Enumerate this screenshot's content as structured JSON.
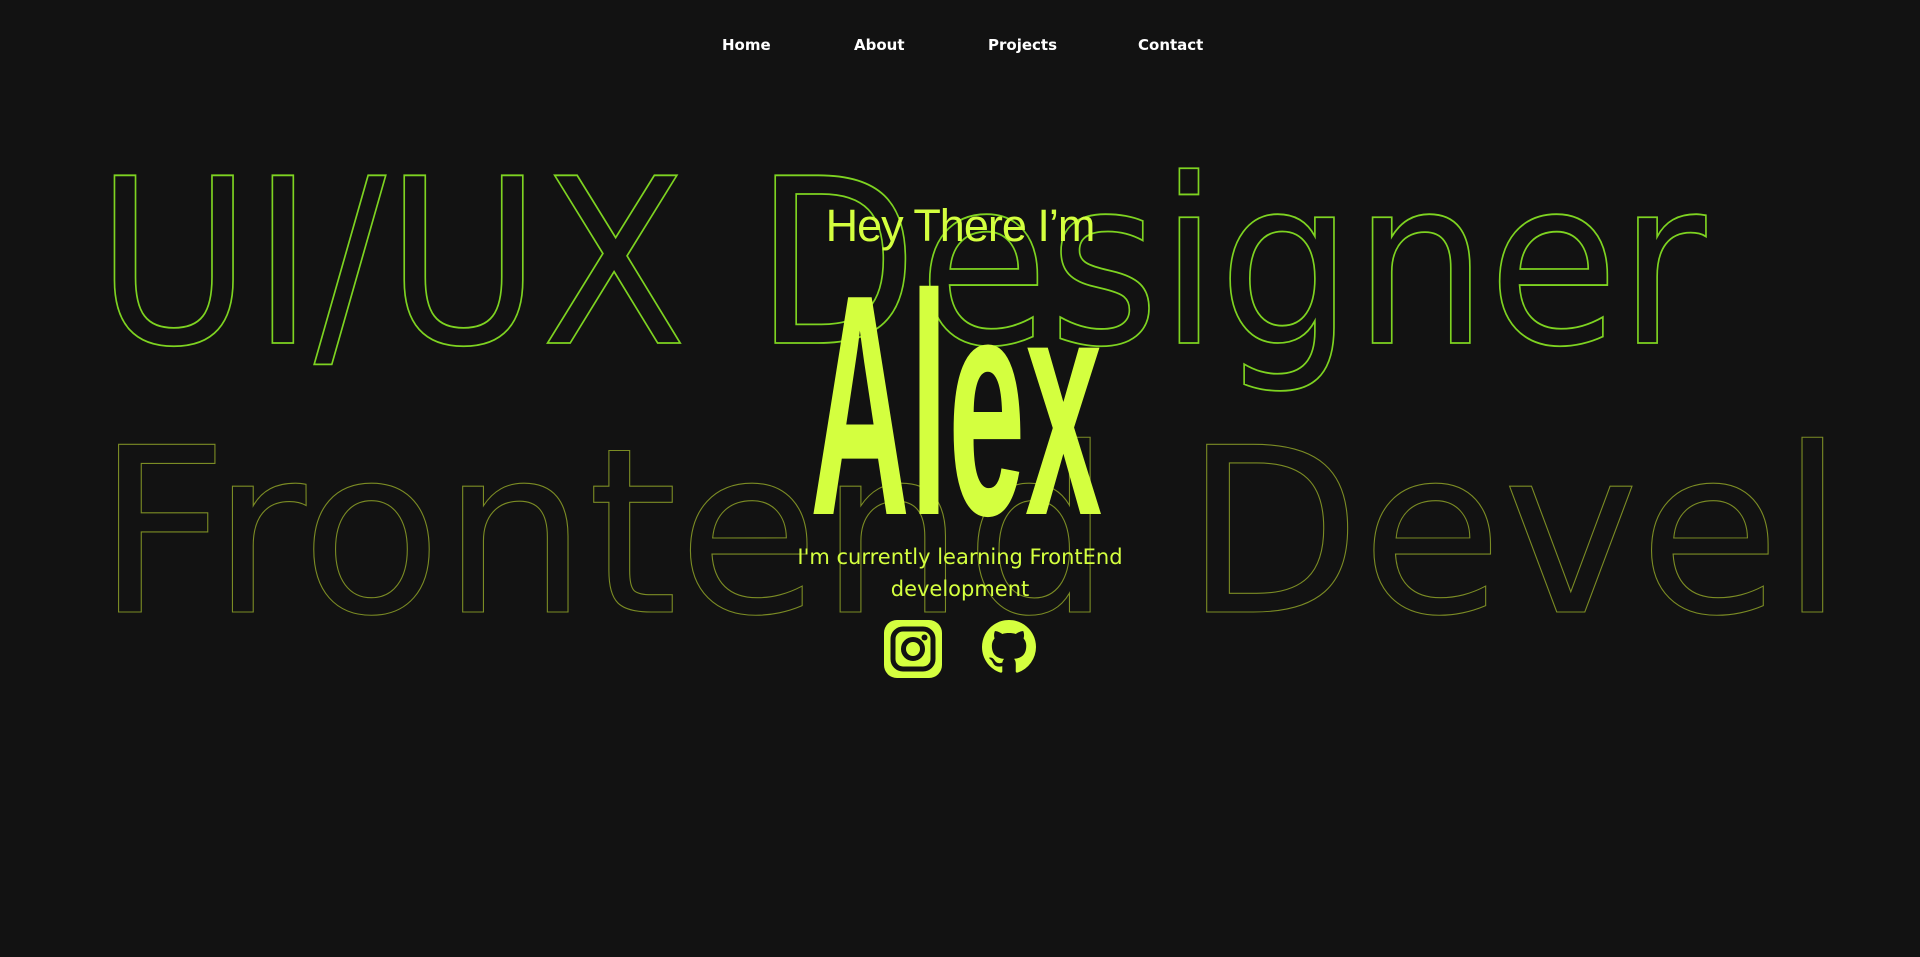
{
  "nav": {
    "items": [
      {
        "label": "Home"
      },
      {
        "label": "About"
      },
      {
        "label": "Projects"
      },
      {
        "label": "Contact"
      }
    ]
  },
  "background": {
    "line1": "UI/UX Designer",
    "line2": "Frontend Developer"
  },
  "hero": {
    "greeting": "Hey There I’m",
    "name": "Alex",
    "tagline": "I'm currently learning FrontEnd development"
  },
  "socials": [
    {
      "icon": "instagram-icon"
    },
    {
      "icon": "github-icon"
    }
  ],
  "colors": {
    "background": "#121212",
    "accent": "#d4ff3f",
    "outline": "#7ed321",
    "nav_text": "#ffffff"
  }
}
